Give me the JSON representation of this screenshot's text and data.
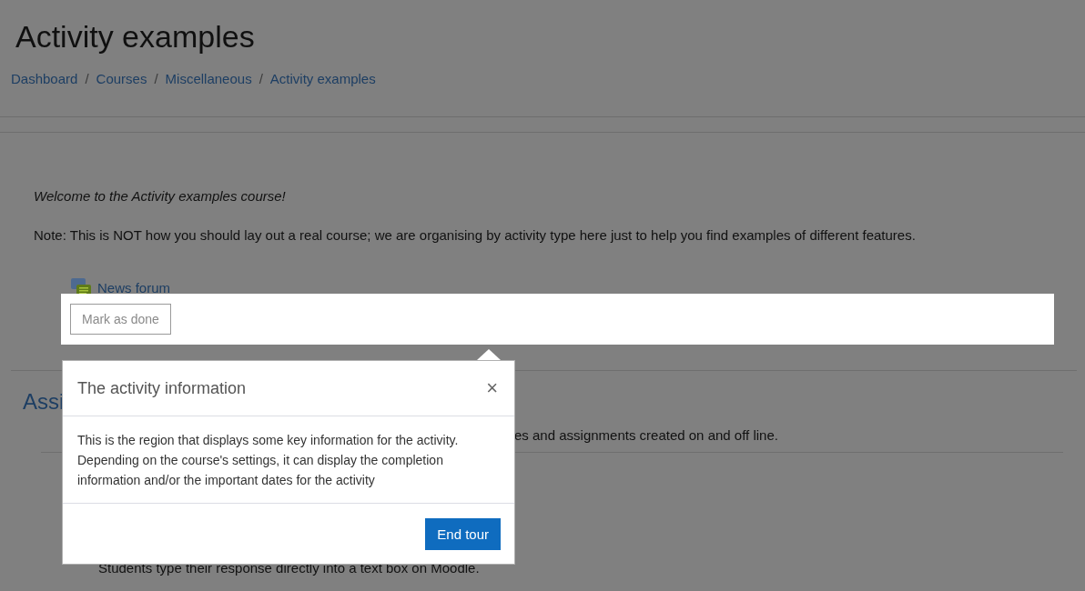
{
  "page": {
    "title": "Activity examples",
    "breadcrumb": [
      {
        "label": "Dashboard"
      },
      {
        "label": "Courses"
      },
      {
        "label": "Miscellaneous"
      },
      {
        "label": "Activity examples"
      }
    ],
    "separator": "/",
    "welcome": "Welcome to the Activity examples course!",
    "note": "Note: This is NOT how you should lay out a real course; we are organising by activity type here just to help you find examples of different features.",
    "activities": [
      {
        "name": "News forum"
      }
    ]
  },
  "section": {
    "heading": "Assi",
    "description": "es and assignments created on and off line.",
    "activity_description": "Students type their response directly into a text box on Moodle."
  },
  "highlight": {
    "button": "Mark as done"
  },
  "tour": {
    "title": "The activity information",
    "close": "×",
    "body": "This is the region that displays some key information for the activity. Depending on the course's settings, it can display the completion information and/or the important dates for the activity",
    "button": "End tour"
  }
}
